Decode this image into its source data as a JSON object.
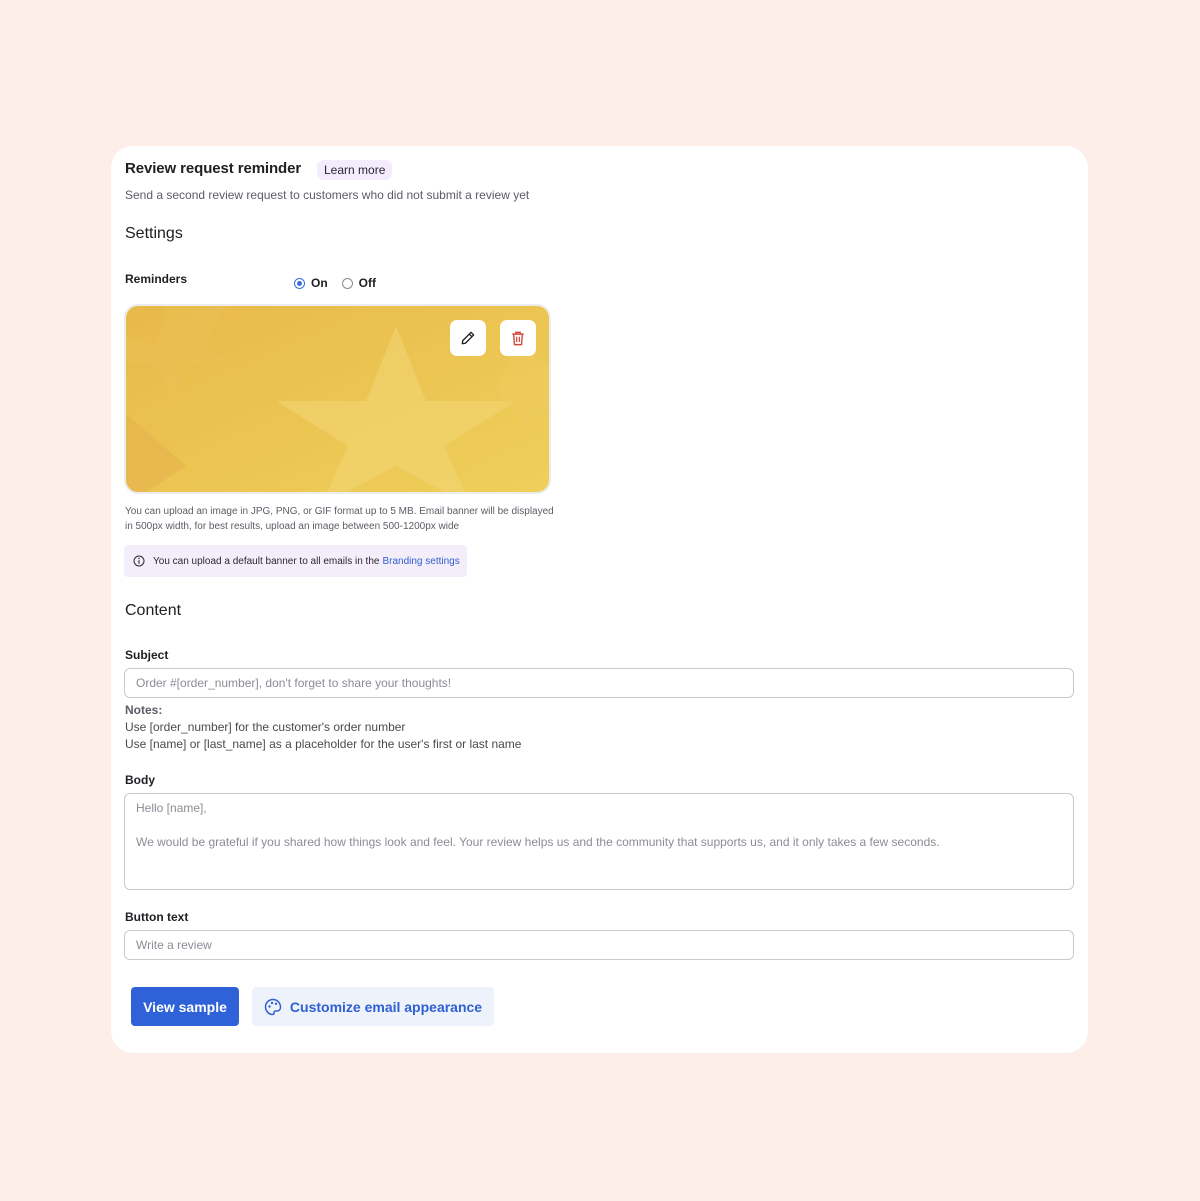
{
  "header": {
    "title": "Review request reminder",
    "learn_more": "Learn more",
    "subtitle": "Send a second review request to customers who did not submit a review yet"
  },
  "settings": {
    "heading": "Settings",
    "reminders_label": "Reminders",
    "radio_on": "On",
    "radio_off": "Off",
    "selected": "On",
    "banner": {
      "edit_icon": "pencil-icon",
      "delete_icon": "trash-icon",
      "colors": {
        "base": "#ecc04c",
        "accent": "#f0d264",
        "delete": "#d2453a"
      }
    },
    "help_text": "You can upload an image in JPG, PNG, or GIF format up to 5 MB. Email banner will be displayed in 500px width, for best results, upload an image between 500-1200px wide",
    "info_text": "You can upload a default banner to all emails in the",
    "info_link": "Branding settings"
  },
  "content": {
    "heading": "Content",
    "subject_label": "Subject",
    "subject_placeholder": "Order #[order_number], don't forget to share your thoughts!",
    "notes_title": "Notes:",
    "notes_line1": "Use [order_number] for the customer's order number",
    "notes_line2": "Use [name] or [last_name] as a placeholder for the user's first or last name",
    "body_label": "Body",
    "body_line1": "Hello [name],",
    "body_line2": "We would be grateful if you shared how things look and feel. Your review helps us and the community that supports us, and it only takes a few seconds.",
    "button_text_label": "Button text",
    "button_text_placeholder": "Write a review"
  },
  "actions": {
    "view_sample": "View sample",
    "customize": "Customize email appearance",
    "customize_icon": "palette-icon",
    "primary_color": "#2f62d8"
  }
}
